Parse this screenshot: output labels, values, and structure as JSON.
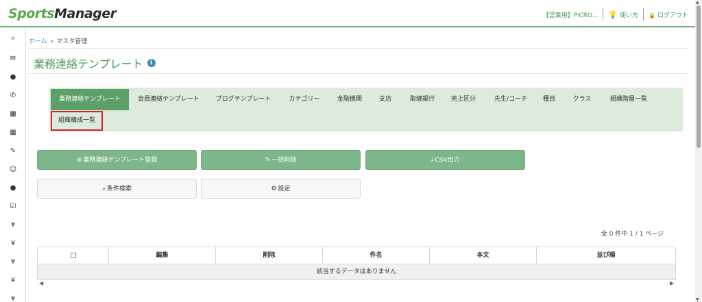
{
  "header": {
    "logo_a": "Sports",
    "logo_b": "Manager",
    "account": "【営業用】PiCRO...",
    "help": "使い方",
    "logout": "ログアウト"
  },
  "sidebar": {
    "toggle": "»",
    "icons": [
      "envelope-icon",
      "chat-bubble-icon",
      "phone-icon",
      "calendar-icon",
      "calendar-check-icon",
      "pencil-icon",
      "smiley-icon",
      "user-icon",
      "checkbox-icon",
      "yen-icon",
      "yen-icon",
      "yen-icon",
      "yen-icon",
      "yen-icon"
    ]
  },
  "breadcrumb": {
    "home": "ホーム",
    "separator": "»",
    "current": "マスタ管理"
  },
  "page": {
    "title": "業務連絡テンプレート",
    "info": "i"
  },
  "tabs": [
    "業務連絡テンプレート",
    "会員連絡テンプレート",
    "ブログテンプレート",
    "カテゴリー",
    "金融機関",
    "支店",
    "取纏銀行",
    "売上区分",
    "先生/コーチ",
    "種目",
    "クラス",
    "組織階層一覧",
    "組織構成一覧"
  ],
  "buttons": {
    "register": "業務連絡テンプレート登録",
    "bulk_delete": "一括削除",
    "csv": "CSV出力",
    "search": "条件検索",
    "settings": "設定"
  },
  "count": "全 0 件中 1 / 1 ページ",
  "table": {
    "headers": [
      "",
      "編集",
      "削除",
      "件名",
      "本文",
      "並び順"
    ],
    "empty": "該当するデータはありません"
  }
}
